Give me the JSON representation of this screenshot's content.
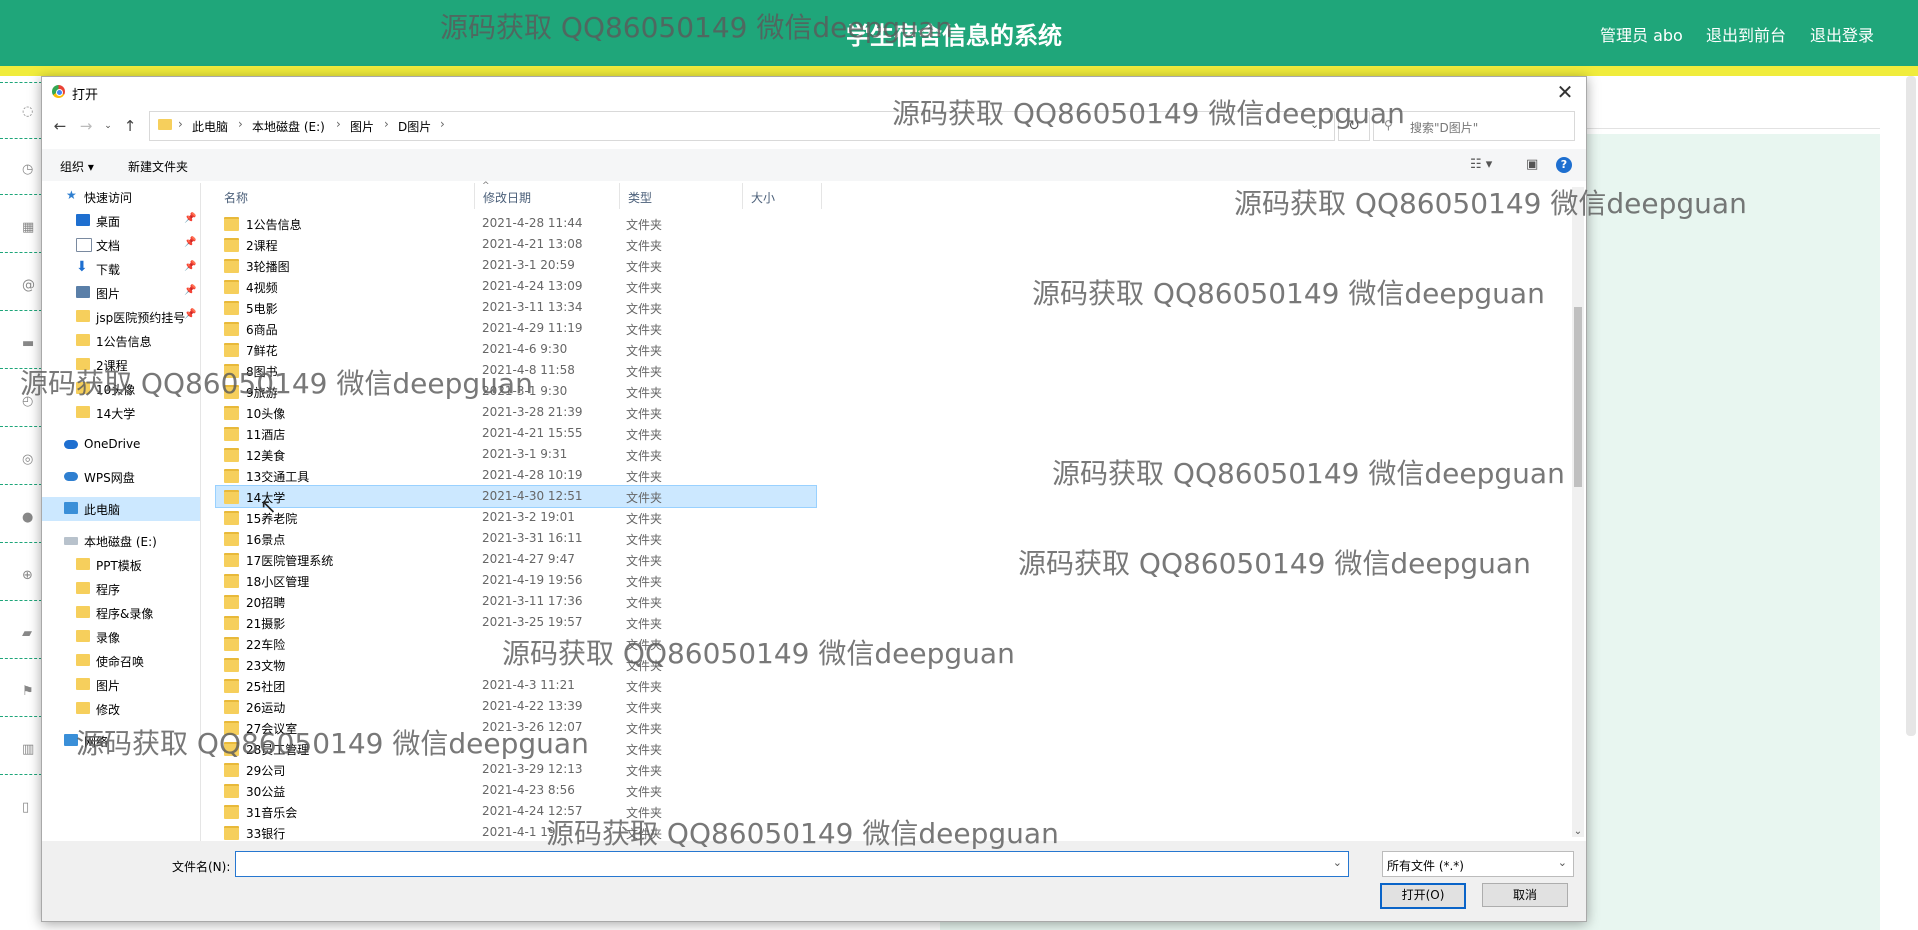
{
  "page": {
    "system_title": "学生宿舍信息的系统",
    "nav_links": [
      "管理员 abo",
      "退出到前台",
      "退出登录"
    ]
  },
  "dialog": {
    "title": "打开",
    "breadcrumb": [
      "此电脑",
      "本地磁盘 (E:)",
      "图片",
      "D图片"
    ],
    "search_placeholder": "搜索\"D图片\"",
    "commands": {
      "organize": "组织 ▾",
      "new_folder": "新建文件夹"
    },
    "nav_pane": [
      {
        "label": "快速访问",
        "icon": "star-icon",
        "level": 1
      },
      {
        "label": "桌面",
        "icon": "desktop-icon",
        "level": 2,
        "pinned": true
      },
      {
        "label": "文档",
        "icon": "document-icon",
        "level": 2,
        "pinned": true
      },
      {
        "label": "下载",
        "icon": "download-icon",
        "level": 2,
        "pinned": true
      },
      {
        "label": "图片",
        "icon": "picture-icon",
        "level": 2,
        "pinned": true
      },
      {
        "label": "jsp医院预约挂号",
        "icon": "folder-icon",
        "level": 2,
        "pinned": true
      },
      {
        "label": "1公告信息",
        "icon": "folder-icon",
        "level": 2
      },
      {
        "label": "2课程",
        "icon": "folder-icon",
        "level": 2
      },
      {
        "label": "10头像",
        "icon": "folder-icon",
        "level": 2
      },
      {
        "label": "14大学",
        "icon": "folder-icon",
        "level": 2
      },
      {
        "label": "OneDrive",
        "icon": "cloud-icon",
        "level": 1
      },
      {
        "label": "WPS网盘",
        "icon": "cloud-icon",
        "level": 1
      },
      {
        "label": "此电脑",
        "icon": "computer-icon",
        "level": 1,
        "selected": true
      },
      {
        "label": "本地磁盘 (E:)",
        "icon": "drive-icon",
        "level": 1
      },
      {
        "label": "PPT模板",
        "icon": "folder-icon",
        "level": 2
      },
      {
        "label": "程序",
        "icon": "folder-icon",
        "level": 2
      },
      {
        "label": "程序&录像",
        "icon": "folder-icon",
        "level": 2
      },
      {
        "label": "录像",
        "icon": "folder-icon",
        "level": 2
      },
      {
        "label": "使命召唤",
        "icon": "folder-icon",
        "level": 2
      },
      {
        "label": "图片",
        "icon": "folder-icon",
        "level": 2
      },
      {
        "label": "修改",
        "icon": "folder-icon",
        "level": 2
      },
      {
        "label": "网络",
        "icon": "network-icon",
        "level": 1
      }
    ],
    "columns": [
      "名称",
      "修改日期",
      "类型",
      "大小"
    ],
    "files": [
      {
        "name": "1公告信息",
        "date": "2021-4-28 11:44",
        "type": "文件夹"
      },
      {
        "name": "2课程",
        "date": "2021-4-21 13:08",
        "type": "文件夹"
      },
      {
        "name": "3轮播图",
        "date": "2021-3-1 20:59",
        "type": "文件夹"
      },
      {
        "name": "4视频",
        "date": "2021-4-24 13:09",
        "type": "文件夹"
      },
      {
        "name": "5电影",
        "date": "2021-3-11 13:34",
        "type": "文件夹"
      },
      {
        "name": "6商品",
        "date": "2021-4-29 11:19",
        "type": "文件夹"
      },
      {
        "name": "7鲜花",
        "date": "2021-4-6 9:30",
        "type": "文件夹"
      },
      {
        "name": "8图书",
        "date": "2021-4-8 11:58",
        "type": "文件夹"
      },
      {
        "name": "9旅游",
        "date": "2021-3-1 9:30",
        "type": "文件夹"
      },
      {
        "name": "10头像",
        "date": "2021-3-28 21:39",
        "type": "文件夹"
      },
      {
        "name": "11酒店",
        "date": "2021-4-21 15:55",
        "type": "文件夹"
      },
      {
        "name": "12美食",
        "date": "2021-3-1 9:31",
        "type": "文件夹"
      },
      {
        "name": "13交通工具",
        "date": "2021-4-28 10:19",
        "type": "文件夹"
      },
      {
        "name": "14大学",
        "date": "2021-4-30 12:51",
        "type": "文件夹",
        "selected": true
      },
      {
        "name": "15养老院",
        "date": "2021-3-2 19:01",
        "type": "文件夹"
      },
      {
        "name": "16景点",
        "date": "2021-3-31 16:11",
        "type": "文件夹"
      },
      {
        "name": "17医院管理系统",
        "date": "2021-4-27 9:47",
        "type": "文件夹"
      },
      {
        "name": "18小区管理",
        "date": "2021-4-19 19:56",
        "type": "文件夹"
      },
      {
        "name": "20招聘",
        "date": "2021-3-11 17:36",
        "type": "文件夹"
      },
      {
        "name": "21摄影",
        "date": "2021-3-25 19:57",
        "type": "文件夹"
      },
      {
        "name": "22车险",
        "date": "",
        "type": "文件夹"
      },
      {
        "name": "23文物",
        "date": "",
        "type": "文件夹"
      },
      {
        "name": "25社团",
        "date": "2021-4-3 11:21",
        "type": "文件夹"
      },
      {
        "name": "26运动",
        "date": "2021-4-22 13:39",
        "type": "文件夹"
      },
      {
        "name": "27会议室",
        "date": "2021-3-26 12:07",
        "type": "文件夹"
      },
      {
        "name": "28员工管理",
        "date": "",
        "type": "文件夹"
      },
      {
        "name": "29公司",
        "date": "2021-3-29 12:13",
        "type": "文件夹"
      },
      {
        "name": "30公益",
        "date": "2021-4-23 8:56",
        "type": "文件夹"
      },
      {
        "name": "31音乐会",
        "date": "2021-4-24 12:57",
        "type": "文件夹"
      },
      {
        "name": "33银行",
        "date": "2021-4-1 19",
        "type": "文件夹"
      }
    ],
    "filename_label": "文件名(N):",
    "filename_value": "",
    "filetype_selected": "所有文件 (*.*)",
    "open_button": "打开(O)",
    "cancel_button": "取消"
  },
  "watermarks": [
    "源码获取 QQ86050149 微信deepguan",
    "源码获取 QQ86050149 微信deepguan",
    "源码获取 QQ86050149 微信deepguan",
    "源码获取 QQ86050149 微信deepguan",
    "源码获取 QQ86050149 微信deepguan",
    "源码获取 QQ86050149 微信deepguan",
    "源码获取 QQ86050149 微信deepguan",
    "源码获取 QQ86050149 微信deepguan",
    "源码获取 QQ86050149 微信deepguan",
    "源码获取 QQ86050149 微信deepguan"
  ]
}
